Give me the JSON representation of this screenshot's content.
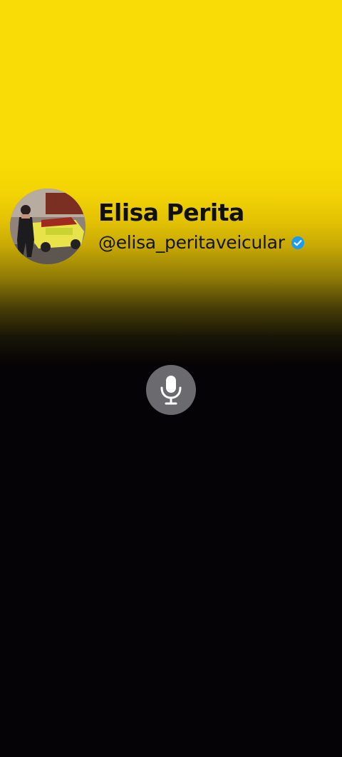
{
  "profile": {
    "name": "Elisa Perita",
    "handle": "@elisa_peritaveicular",
    "verified": true,
    "avatar_icon": "profile-photo"
  },
  "colors": {
    "background_top": "#f9dc05",
    "background_bottom": "#050306",
    "verified_badge": "#1d9bf0",
    "mic_button": "#6b6a6e"
  },
  "controls": {
    "mic_icon": "microphone-icon"
  }
}
